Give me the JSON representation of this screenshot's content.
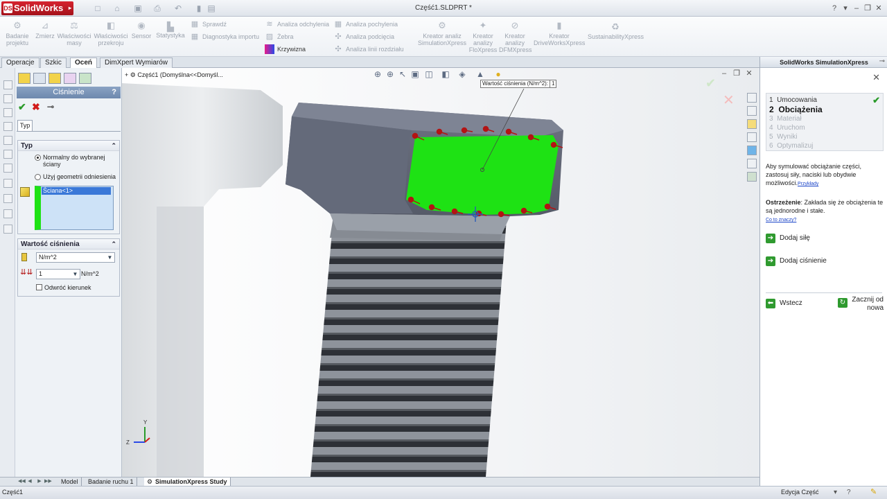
{
  "app": {
    "name": "SolidWorks",
    "document_title": "Część1.SLDPRT *"
  },
  "ribbon": {
    "buttons": [
      "Badanie projektu",
      "Zmierz",
      "Właściwości masy",
      "Właściwości przekroju",
      "Sensor",
      "Statystyka"
    ],
    "small_tools": [
      "Sprawdź",
      "Diagnostyka importu",
      "Analiza odchylenia",
      "Żebra",
      "Krzywizna",
      "Analiza pochylenia",
      "Analiza podcięcia",
      "Analiza linii rozdziału"
    ],
    "xpress": [
      "Kreator analiz SimulationXpress",
      "Kreator analizy FloXpress",
      "Kreator analizy DFMXpress",
      "Kreator DriveWorksXpress",
      "SustainabilityXpress"
    ]
  },
  "command_tabs": [
    "Operacje",
    "Szkic",
    "Oceń",
    "DimXpert Wymiarów"
  ],
  "property_manager": {
    "title": "Ciśnienie",
    "help": "?",
    "tab_label": "Typ",
    "type_group": {
      "title": "Typ",
      "option_normal": "Normalny do wybranej ściany",
      "option_reference": "Użyj geometrii odniesienia",
      "selected_face": "Ściana<1>"
    },
    "value_group": {
      "title": "Wartość ciśnienia",
      "unit": "N/m^2",
      "value": "1",
      "value_unit": "N/m^2",
      "reverse_label": "Odwróć kierunek"
    }
  },
  "viewport": {
    "tree_path": "Część1  (Domyślna<<Domyśl...",
    "callout_label": "Wartość ciśnienia (N/m^2):",
    "callout_value": "1",
    "triad_labels": [
      "Z",
      "Y"
    ]
  },
  "bottom_tabs": [
    "Model",
    "Badanie ruchu 1",
    "SimulationXpress Study"
  ],
  "status": {
    "left": "Część1",
    "right": "Edycja Część"
  },
  "task_pane": {
    "title": "SolidWorks SimulationXpress",
    "steps": [
      {
        "num": "1",
        "label": "Umocowania",
        "state": "done"
      },
      {
        "num": "2",
        "label": "Obciążenia",
        "state": "current"
      },
      {
        "num": "3",
        "label": "Materiał",
        "state": "pending"
      },
      {
        "num": "4",
        "label": "Uruchom",
        "state": "pending"
      },
      {
        "num": "5",
        "label": "Wyniki",
        "state": "pending"
      },
      {
        "num": "6",
        "label": "Optymalizuj",
        "state": "pending"
      }
    ],
    "intro": "Aby symulować obciążanie części, zastosuj siły, naciski lub obydwie możliwości.",
    "intro_link": "Przykłady",
    "warning_label": "Ostrzeżenie",
    "warning_text": ": Zakłada się że obciążenia te są jednorodne i stałe.",
    "warning_link": "Co to znaczy?",
    "add_force": "Dodaj siłę",
    "add_pressure": "Dodaj ciśnienie",
    "back": "Wstecz",
    "restart": "Zacznij od nowa"
  },
  "colors": {
    "selected_face": "#1ee214",
    "arrows": "#b31414",
    "accent": "#c41a24"
  }
}
